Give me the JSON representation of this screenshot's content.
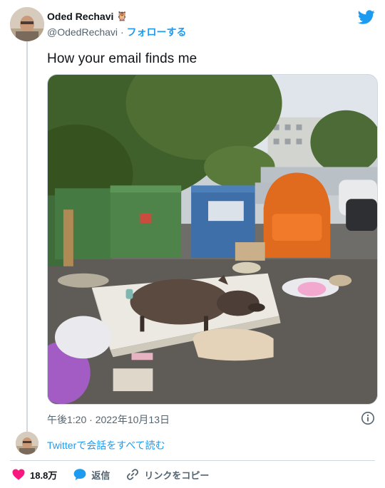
{
  "author": {
    "name": "Oded Rechavi",
    "name_emoji": "🦉",
    "handle": "@OdedRechavi",
    "separator": "·",
    "follow_label": "フォローする"
  },
  "tweet": {
    "text": "How your email finds me",
    "timestamp": "午後1:20 · 2022年10月13日"
  },
  "thread": {
    "read_all_label": "Twitterで会話をすべて読む"
  },
  "actions": {
    "like_count": "18.8万",
    "reply_label": "返信",
    "copy_link_label": "リンクをコピー"
  },
  "colors": {
    "twitter_blue": "#1d9bf0",
    "like_pink": "#f91880",
    "text_secondary": "#536471",
    "border": "#cfd9de"
  },
  "icons": {
    "brand": "twitter-bird-icon",
    "info": "info-icon",
    "like": "heart-icon",
    "reply": "speech-bubble-icon",
    "link": "link-icon"
  }
}
